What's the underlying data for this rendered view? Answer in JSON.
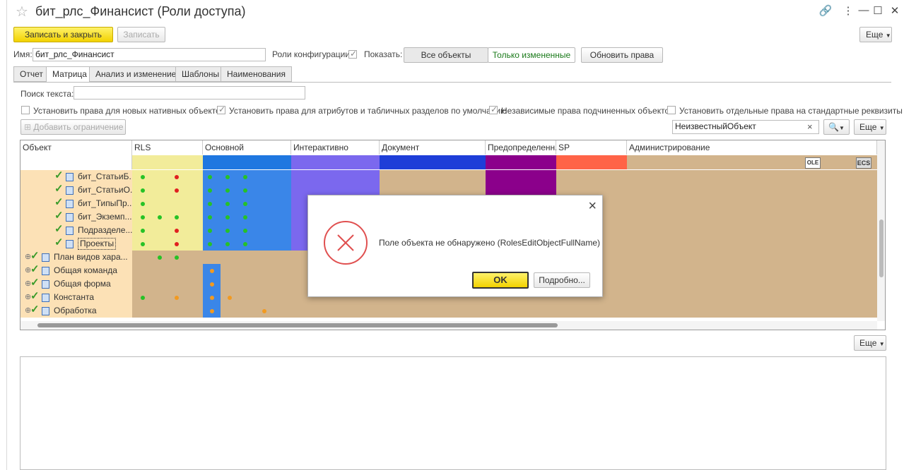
{
  "window": {
    "title": "бит_рлс_Финансист (Роли доступа)"
  },
  "toolbar": {
    "save_close": "Записать и закрыть",
    "save": "Записать",
    "more": "Еще"
  },
  "form": {
    "name_label": "Имя:",
    "name_value": "бит_рлс_Финансист",
    "config_roles_label": "Роли конфигурации:",
    "show_label": "Показать:",
    "show_all": "Все объекты",
    "show_changed": "Только измененные",
    "update_rights": "Обновить права"
  },
  "tabs": [
    "Отчет",
    "Матрица",
    "Анализ и изменение",
    "Шаблоны",
    "Наименования"
  ],
  "search": {
    "label": "Поиск текста:",
    "value": ""
  },
  "options": [
    {
      "label": "Установить права для новых нативных объектов",
      "checked": false
    },
    {
      "label": "Установить права для атрибутов и табличных разделов по умолчанию",
      "checked": true
    },
    {
      "label": "Независимые права подчиненных объектов",
      "checked": true
    },
    {
      "label": "Установить отдельные права на стандартные реквизиты",
      "checked": false
    }
  ],
  "restriction": {
    "add_label": "Добавить ограничение",
    "filter_value": "НеизвестныйОбъект",
    "clear": "×",
    "search_icon": "search-icon",
    "more": "Еще"
  },
  "grid": {
    "object_header": "Объект",
    "groups": [
      "RLS",
      "Основной",
      "Интерактивно",
      "Документ",
      "Предопределенн...",
      "SP",
      "Администрирование"
    ],
    "admin_text_icons": [
      "OLE",
      "ECS"
    ],
    "rows": [
      {
        "name": "бит_СтатьиБ...",
        "level": 2
      },
      {
        "name": "бит_СтатьиО...",
        "level": 2
      },
      {
        "name": "бит_ТипыПр...",
        "level": 2
      },
      {
        "name": "бит_Экземп...",
        "level": 2
      },
      {
        "name": "Подразделе...",
        "level": 2
      },
      {
        "name": "Проекты",
        "level": 2,
        "selected": true
      },
      {
        "name": "План видов хара...",
        "level": 1
      },
      {
        "name": "Общая команда",
        "level": 1
      },
      {
        "name": "Общая форма",
        "level": 1
      },
      {
        "name": "Константа",
        "level": 1
      },
      {
        "name": "Обработка",
        "level": 1
      }
    ]
  },
  "bottom": {
    "more": "Еще"
  },
  "dialog": {
    "message": "Поле объекта не обнаружено (RolesEditObjectFullName)",
    "ok": "OK",
    "details": "Подробно...",
    "close": "×"
  },
  "colors": {
    "rls": "#f2ec9a",
    "basic": "#3a86e8",
    "interactive": "#7b68ee",
    "predefined": "#8b008b",
    "sp": "#ff6347",
    "tan": "#d2b48c",
    "row_name_bg": "#fce1b6",
    "accent_yellow": "#f2d200"
  }
}
